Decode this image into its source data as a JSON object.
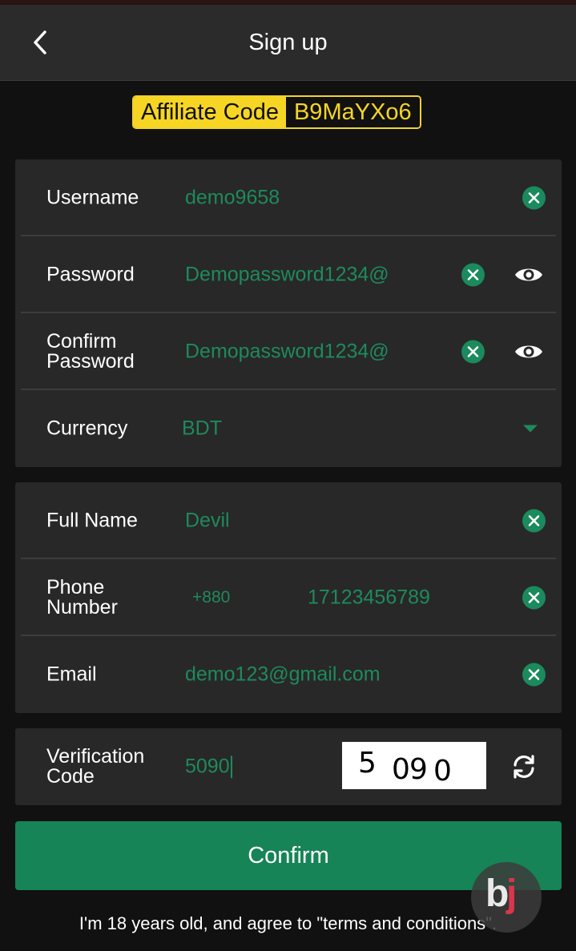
{
  "header": {
    "title": "Sign up"
  },
  "affiliate": {
    "label": "Affiliate Code",
    "code": "B9MaYXo6"
  },
  "account": {
    "username": {
      "label": "Username",
      "value": "demo9658"
    },
    "password": {
      "label": "Password",
      "value": "Demopassword1234@"
    },
    "confirm_password": {
      "label_line1": "Confirm",
      "label_line2": "Password",
      "value": "Demopassword1234@"
    },
    "currency": {
      "label": "Currency",
      "value": "BDT"
    }
  },
  "profile": {
    "full_name": {
      "label": "Full Name",
      "value": "Devil"
    },
    "phone": {
      "label_line1": "Phone",
      "label_line2": "Number",
      "country_code": "+880",
      "value": "17123456789"
    },
    "email": {
      "label": "Email",
      "value": "demo123@gmail.com"
    }
  },
  "verification": {
    "label_line1": "Verification",
    "label_line2": "Code",
    "value": "5090",
    "captcha": [
      "5",
      "0",
      "9",
      "0"
    ]
  },
  "confirm_label": "Confirm",
  "terms_text": "I'm 18 years old, and agree to \"terms and conditions\".",
  "logo": {
    "b": "b",
    "j": "j"
  },
  "colors": {
    "accent": "#1b8a5d",
    "affiliate": "#f7d524",
    "background": "#111111",
    "card": "#282828"
  },
  "icons": [
    "back-arrow-icon",
    "clear-icon",
    "eye-icon",
    "caret-down-icon",
    "refresh-icon"
  ]
}
